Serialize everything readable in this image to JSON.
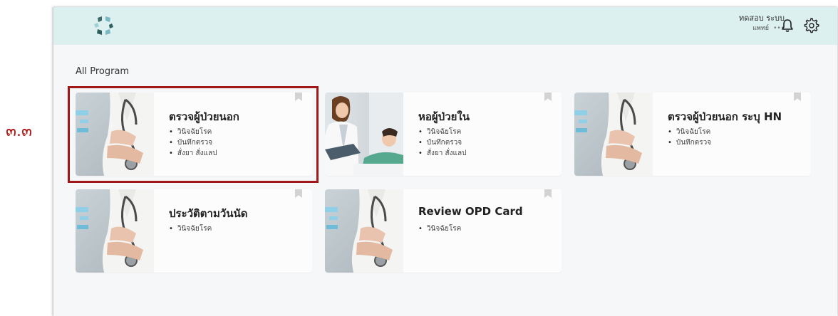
{
  "annotation": {
    "step_label": "๓.๓"
  },
  "header": {
    "user_name": "ทดสอบ ระบบ",
    "user_role": "แพทย์",
    "user_role_suffix": "•••",
    "bell_icon": "bell-icon",
    "settings_icon": "gear-icon",
    "accent_color": "#dcf1ef"
  },
  "main": {
    "section_title": "All Program",
    "cards": [
      {
        "title": "ตรวจผู้ป่วยนอก",
        "image": "doctor-stethoscope",
        "items": [
          "วินิจฉัยโรค",
          "บันทึกตรวจ",
          "สั่งยา สั่งแลป"
        ],
        "highlighted": true
      },
      {
        "title": "หอผู้ป่วยใน",
        "image": "nurse-patient",
        "items": [
          "วินิจฉัยโรค",
          "บันทึกตรวจ",
          "สั่งยา สั่งแลป"
        ]
      },
      {
        "title": "ตรวจผู้ป่วยนอก ระบุ HN",
        "image": "doctor-stethoscope",
        "items": [
          "วินิจฉัยโรค",
          "บันทึกตรวจ"
        ]
      },
      {
        "title": "ประวัติตามวันนัด",
        "image": "doctor-stethoscope",
        "items": [
          "วินิจฉัยโรค"
        ]
      },
      {
        "title": "Review OPD Card",
        "image": "doctor-stethoscope",
        "items": [
          "วินิจฉัยโรค"
        ]
      }
    ]
  },
  "colors": {
    "highlight_border": "#a01818",
    "step_label": "#b01818"
  }
}
